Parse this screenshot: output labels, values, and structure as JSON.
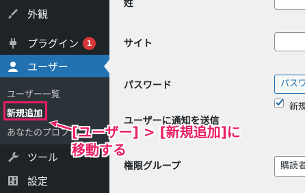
{
  "sidebar": {
    "items": [
      {
        "label": "外観",
        "icon": "paintbrush-icon"
      },
      {
        "label": "プラグイン",
        "icon": "plugin-icon",
        "badge": "1"
      },
      {
        "label": "ユーザー",
        "icon": "user-icon"
      },
      {
        "label": "ツール",
        "icon": "wrench-icon"
      },
      {
        "label": "設定",
        "icon": "settings-icon"
      }
    ],
    "submenu": [
      "ユーザー一覧",
      "新規追加",
      "あなたのプロフ"
    ]
  },
  "form": {
    "rows": [
      {
        "label": "姓"
      },
      {
        "label": "サイト"
      },
      {
        "label": "パスワード",
        "button": "パスワ"
      },
      {
        "label": "ユーザーに通知を送信",
        "checkbox_label": "新規"
      },
      {
        "label": "権限グループ",
        "select_value": "購読者"
      }
    ]
  },
  "annotation": {
    "line1": "[ユーザー] > [新規追加]に",
    "line2": "移動する"
  },
  "colors": {
    "sidebar_bg": "#1d2327",
    "submenu_bg": "#2c3338",
    "current_bg": "#2271b1",
    "badge": "#d63638",
    "annotation": "#e91e63"
  }
}
